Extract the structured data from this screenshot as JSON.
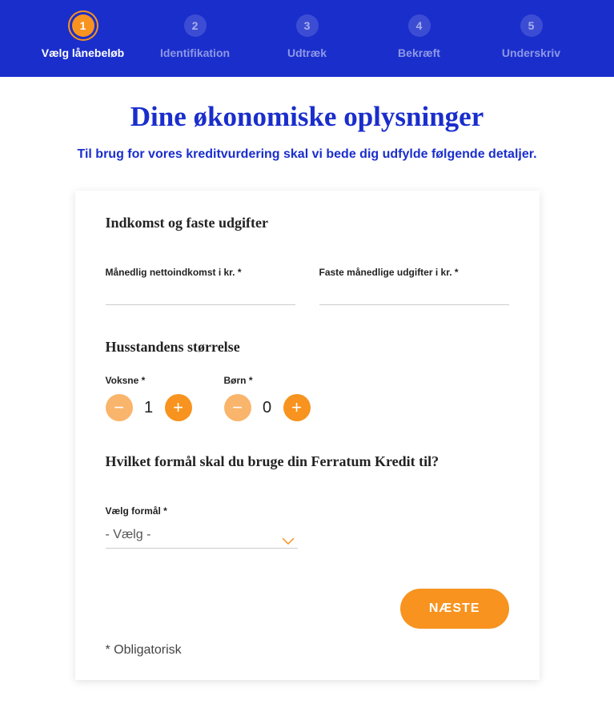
{
  "stepper": {
    "active_index": 0,
    "steps": [
      {
        "num": "1",
        "label": "Vælg lånebeløb"
      },
      {
        "num": "2",
        "label": "Identifikation"
      },
      {
        "num": "3",
        "label": "Udtræk"
      },
      {
        "num": "4",
        "label": "Bekræft"
      },
      {
        "num": "5",
        "label": "Underskriv"
      }
    ]
  },
  "page": {
    "title": "Dine økonomiske oplysninger",
    "subtitle": "Til brug for vores kreditvurdering skal vi bede dig udfylde følgende detaljer."
  },
  "form": {
    "income_section_heading": "Indkomst og faste udgifter",
    "net_income_label": "Månedlig nettoindkomst i kr. *",
    "net_income_value": "",
    "fixed_expenses_label": "Faste månedlige udgifter i kr. *",
    "fixed_expenses_value": "",
    "household_heading": "Husstandens størrelse",
    "adults_label": "Voksne *",
    "adults_value": "1",
    "children_label": "Børn *",
    "children_value": "0",
    "purpose_heading": "Hvilket formål skal du bruge din Ferratum Kredit til?",
    "purpose_field_label": "Vælg formål *",
    "purpose_selected": "- Vælg -",
    "next_label": "NÆSTE",
    "mandatory_note": "* Obligatorisk"
  }
}
